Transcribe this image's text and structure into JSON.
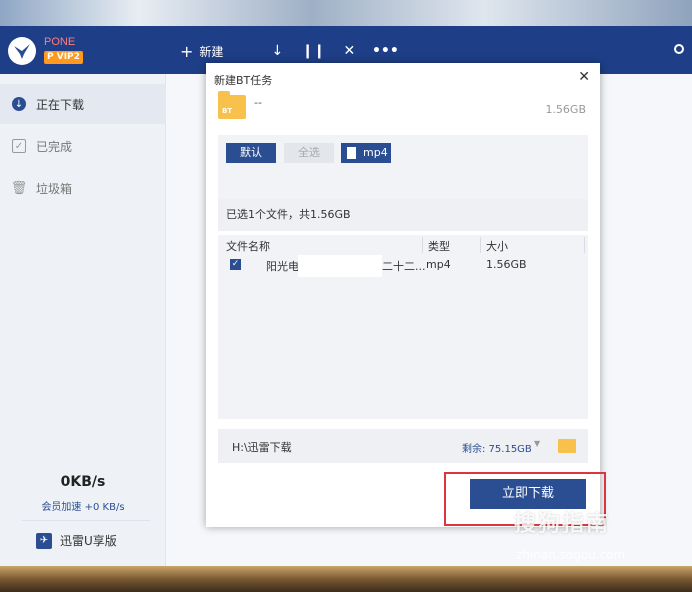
{
  "app": {
    "brand_name": "PONE",
    "vip_badge": "P VIP2",
    "toolbar": {
      "new_label": "新建",
      "new_icon": "plus-icon",
      "download_icon": "download-arrow-icon",
      "pause_icon": "pause-icon",
      "delete_icon": "close-icon",
      "more_icon": "more-dots-icon"
    }
  },
  "sidebar": {
    "items": [
      {
        "label": "正在下载",
        "icon": "download-circle-icon",
        "active": true
      },
      {
        "label": "已完成",
        "icon": "check-box-icon",
        "active": false
      },
      {
        "label": "垃圾箱",
        "icon": "trash-icon",
        "active": false
      }
    ],
    "speed_value": "0KB/s",
    "vip_speed": "会员加速 +0 KB/s",
    "u_version": "迅雷U享版"
  },
  "dialog": {
    "title": "新建BT任务",
    "folder_badge": "BT",
    "task_name": "--",
    "task_size": "1.56GB",
    "filters": {
      "default_label": "默认",
      "select_all_label": "全选",
      "mp4_label": "mp4"
    },
    "summary": "已选1个文件，共1.56GB",
    "columns": {
      "name": "文件名称",
      "type": "类型",
      "size": "大小"
    },
    "files": [
      {
        "name_prefix": "阳光电",
        "name_suffix": "二十二...",
        "type": "mp4",
        "size": "1.56GB",
        "checked": true
      }
    ],
    "save_path": "H:\\迅雷下载",
    "free_space": "剩余: 75.15GB",
    "download_now": "立即下载"
  },
  "watermark": {
    "main": "搜狗指南",
    "sub": "zhinan.sogou.com"
  },
  "colors": {
    "titlebar": "#1e3f87",
    "accent": "#2b4e93",
    "highlight": "#d9363e",
    "folder": "#f7c14b"
  }
}
